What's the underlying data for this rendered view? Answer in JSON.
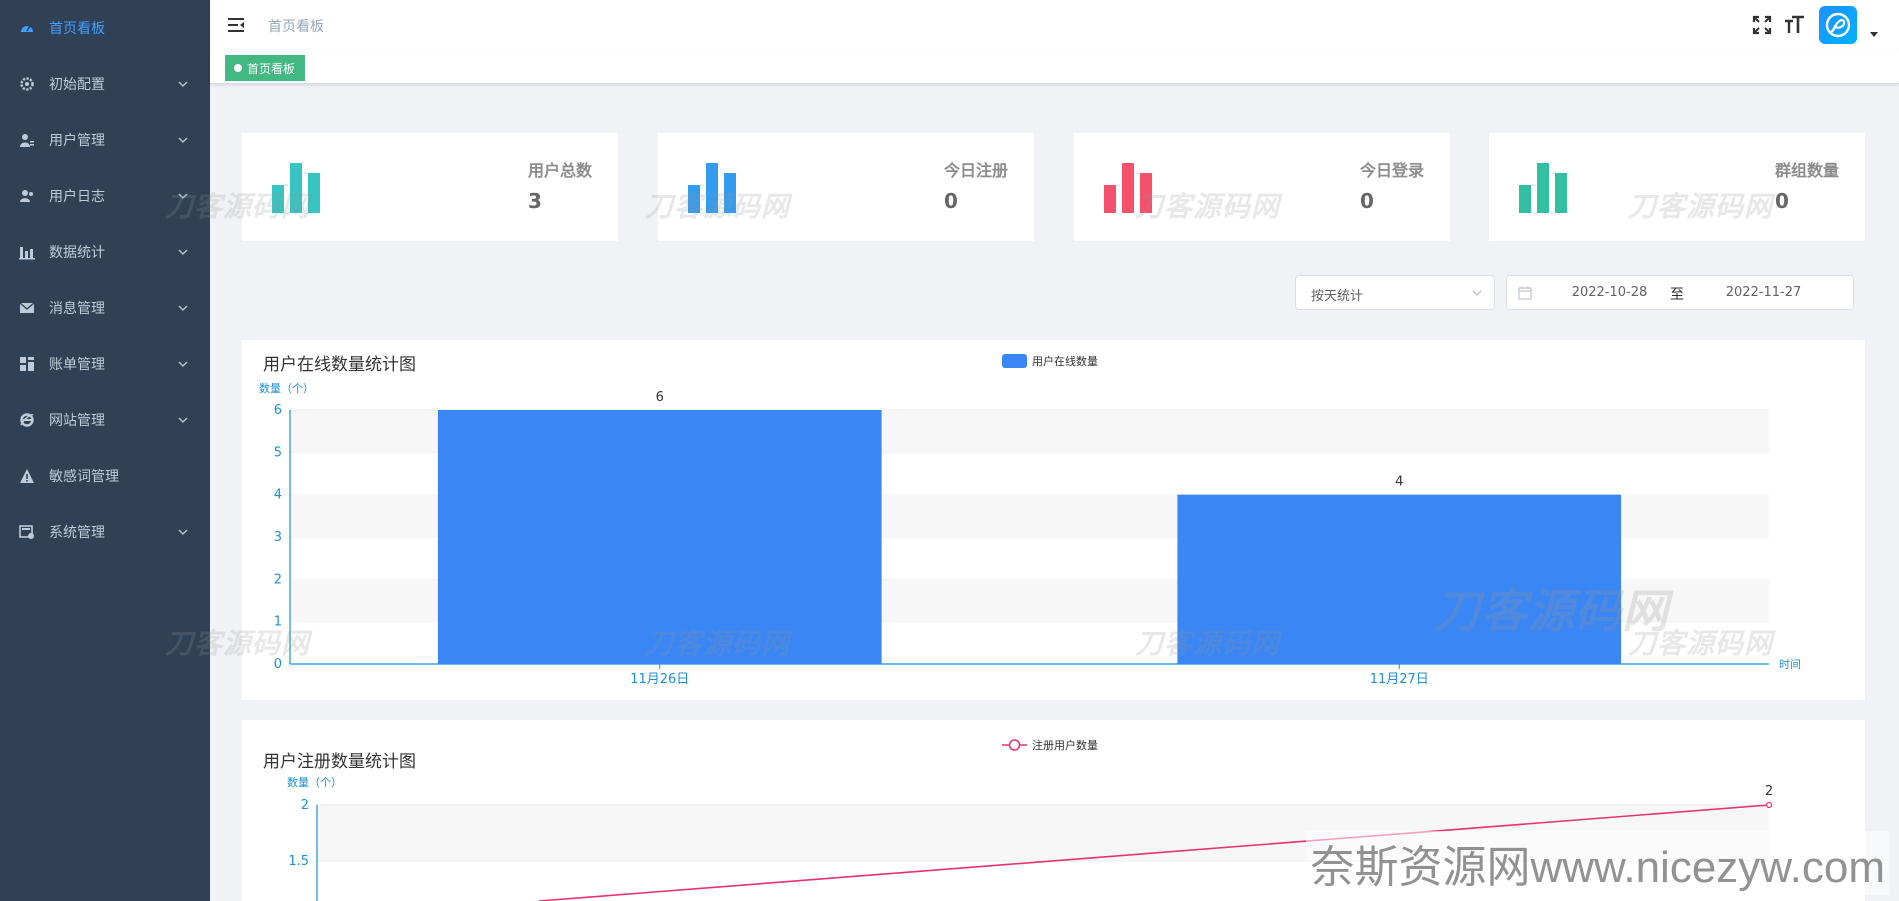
{
  "sidebar": {
    "items": [
      {
        "label": "首页看板",
        "icon": "dashboard-icon",
        "active": true,
        "expandable": false
      },
      {
        "label": "初始配置",
        "icon": "gear-icon",
        "active": false,
        "expandable": true
      },
      {
        "label": "用户管理",
        "icon": "user-icon",
        "active": false,
        "expandable": true
      },
      {
        "label": "用户日志",
        "icon": "users-log-icon",
        "active": false,
        "expandable": true
      },
      {
        "label": "数据统计",
        "icon": "bar-chart-icon",
        "active": false,
        "expandable": true
      },
      {
        "label": "消息管理",
        "icon": "mail-icon",
        "active": false,
        "expandable": true
      },
      {
        "label": "账单管理",
        "icon": "grid-icon",
        "active": false,
        "expandable": true
      },
      {
        "label": "网站管理",
        "icon": "ie-icon",
        "active": false,
        "expandable": true
      },
      {
        "label": "敏感词管理",
        "icon": "warning-icon",
        "active": false,
        "expandable": false
      },
      {
        "label": "系统管理",
        "icon": "system-icon",
        "active": false,
        "expandable": true
      }
    ]
  },
  "header": {
    "breadcrumb": "首页看板",
    "icons": [
      "hamburger-icon",
      "fullscreen-icon",
      "font-size-icon",
      "avatar",
      "caret-down-icon"
    ]
  },
  "tags": {
    "active_tag": "首页看板"
  },
  "stats": [
    {
      "title": "用户总数",
      "value": "3",
      "color": "#36c5c0"
    },
    {
      "title": "今日注册",
      "value": "0",
      "color": "#349cf0"
    },
    {
      "title": "今日登录",
      "value": "0",
      "color": "#f4516c"
    },
    {
      "title": "群组数量",
      "value": "0",
      "color": "#34bfa3"
    }
  ],
  "filters": {
    "mode": "按天统计",
    "date_start": "2022-10-28",
    "date_sep": "至",
    "date_end": "2022-11-27"
  },
  "watermark": "刀客源码网",
  "footer_watermark": "奈斯资源网www.nicezyw.com",
  "colors": {
    "sidebar_bg": "#304156",
    "sidebar_text": "#bfcbd9",
    "active": "#409eff",
    "tag": "#42b983",
    "bar": "#3a86f5",
    "line": "#e8326e",
    "axis": "#1e90d6"
  },
  "chart_data": [
    {
      "type": "bar",
      "title": "用户在线数量统计图",
      "legend": "用户在线数量",
      "ylabel": "数量（个）",
      "xlabel": "时间",
      "categories": [
        "11月26日",
        "11月27日"
      ],
      "series": [
        {
          "name": "用户在线数量",
          "values": [
            6,
            4
          ]
        }
      ],
      "ylim": [
        0,
        6
      ],
      "yticks": [
        0,
        1,
        2,
        3,
        4,
        5,
        6
      ],
      "data_labels": true,
      "grid": "striped"
    },
    {
      "type": "line",
      "title": "用户注册数量统计图",
      "legend": "注册用户数量",
      "ylabel": "数量（个）",
      "yticks_visible": [
        "2",
        "1.5"
      ],
      "ylim": [
        0,
        2
      ],
      "last_point_label": "2"
    }
  ]
}
